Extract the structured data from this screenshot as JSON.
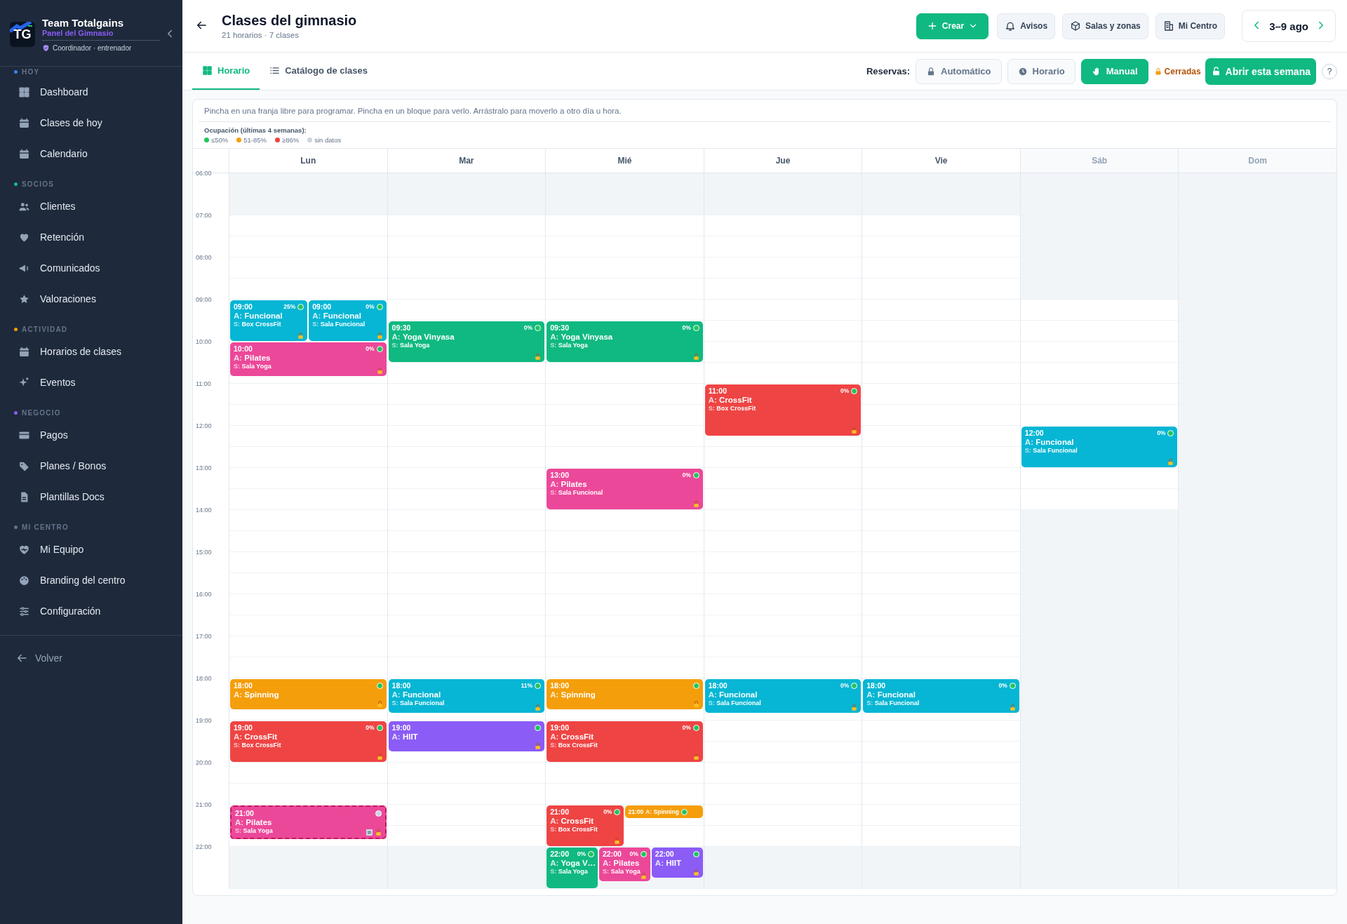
{
  "sidebar": {
    "logo_text": "TG",
    "brand": "Team Totalgains",
    "subtitle": "Panel del Gimnasio",
    "role": "Coordinador · entrenador",
    "sections": [
      {
        "title": "HOY",
        "color": "#3b82f6",
        "items": [
          {
            "label": "Dashboard",
            "selected": false
          },
          {
            "label": "Clases de hoy",
            "selected": false
          },
          {
            "label": "Calendario",
            "selected": false
          }
        ]
      },
      {
        "title": "SOCIOS",
        "color": "#14b8a6",
        "items": [
          {
            "label": "Clientes",
            "selected": false
          },
          {
            "label": "Retención",
            "selected": false
          },
          {
            "label": "Comunicados",
            "selected": false
          },
          {
            "label": "Valoraciones",
            "selected": false
          }
        ]
      },
      {
        "title": "ACTIVIDAD",
        "color": "#f59e0b",
        "items": [
          {
            "label": "Horarios de clases",
            "selected": false
          },
          {
            "label": "Eventos",
            "selected": false
          }
        ]
      },
      {
        "title": "NEGOCIO",
        "color": "#8b5cf6",
        "items": [
          {
            "label": "Pagos",
            "selected": false
          },
          {
            "label": "Planes / Bonos",
            "selected": false
          },
          {
            "label": "Plantillas Docs",
            "selected": false
          }
        ]
      },
      {
        "title": "MI CENTRO",
        "color": "#64748b",
        "items": [
          {
            "label": "Mi Equipo",
            "selected": false
          },
          {
            "label": "Branding del centro",
            "selected": false
          },
          {
            "label": "Configuración",
            "selected": false
          }
        ]
      }
    ],
    "back": "Volver"
  },
  "header": {
    "title": "Clases del gimnasio",
    "subtitle": "21 horarios · 7 clases",
    "buttons": [
      {
        "label": "Crear",
        "kind": "primary"
      },
      {
        "label": "Avisos",
        "kind": "bell"
      },
      {
        "label": "Salas y zonas",
        "kind": "cube"
      },
      {
        "label": "Mi Centro",
        "kind": "building"
      }
    ],
    "week": "3–9 ago"
  },
  "tabs": [
    {
      "label": "Horario",
      "selected": true
    },
    {
      "label": "Catálogo de clases",
      "selected": false
    }
  ],
  "bookings": {
    "label": "Reservas:",
    "modes": [
      {
        "label": "Automático",
        "kind": "lock",
        "selected": false
      },
      {
        "label": "Horario",
        "kind": "clock",
        "selected": false
      },
      {
        "label": "Manual",
        "kind": "hand",
        "selected": true
      }
    ],
    "status": "Cerradas",
    "open_button": "Abrir esta semana",
    "help": "?"
  },
  "calendar": {
    "hint": "Pincha en una franja libre para programar. Pincha en un bloque para verlo. Arrástralo para moverlo a otro día u hora.",
    "legend_title": "Ocupación (últimas 4 semanas):",
    "legend": [
      {
        "label": "≤50%",
        "color": "#22c55e"
      },
      {
        "label": "51-85%",
        "color": "#f59e0b"
      },
      {
        "label": "≥86%",
        "color": "#ef4444"
      },
      {
        "label": "sin datos",
        "color": "#cbd5e1"
      }
    ],
    "hours": [
      "06:00",
      "07:00",
      "08:00",
      "09:00",
      "10:00",
      "11:00",
      "12:00",
      "13:00",
      "14:00",
      "15:00",
      "16:00",
      "17:00",
      "18:00",
      "19:00",
      "20:00",
      "21:00",
      "22:00"
    ],
    "days": [
      {
        "label": "Lun",
        "kind": "weekday",
        "events": [
          {
            "time": "09:00",
            "kind": "full",
            "title": "A: **Funcional**",
            "room": "S: **Box CrossFit**",
            "color": "#06b6d4",
            "occupancy": {
              "text": "25%",
              "color": "#22c55e"
            },
            "locked": true,
            "draft": false,
            "recurring": false
          },
          {
            "time": "09:00",
            "kind": "full",
            "title": "A: **Funcional**",
            "room": "S: **Sala Funcional**",
            "color": "#06b6d4",
            "occupancy": {
              "text": "0%",
              "color": "#22c55e"
            },
            "locked": true,
            "draft": false,
            "recurring": false
          },
          {
            "time": "10:00",
            "kind": "medium",
            "title": "A: **Pilates**",
            "room": "S: **Sala Yoga**",
            "color": "#ec4899",
            "occupancy": {
              "text": "0%",
              "color": "#22c55e"
            },
            "locked": true,
            "draft": false,
            "recurring": false
          },
          {
            "time": "18:00",
            "kind": "short",
            "title": "A: **Spinning**",
            "color": "#f59e0b",
            "occupancy": {
              "color": "#22c55e"
            },
            "locked": true,
            "draft": false,
            "recurring": false
          },
          {
            "time": "19:00",
            "kind": "full",
            "title": "A: **CrossFit**",
            "room": "S: **Box CrossFit**",
            "color": "#ef4444",
            "occupancy": {
              "text": "0%",
              "color": "#22c55e"
            },
            "locked": true,
            "draft": false,
            "recurring": false
          },
          {
            "time": "21:00",
            "kind": "medium",
            "title": "A: **Pilates**",
            "room": "S: **Sala Yoga**",
            "color": "#ec4899",
            "occupancy": {
              "color": "#cbd5e1"
            },
            "locked": true,
            "draft": true,
            "recurring": true
          }
        ]
      },
      {
        "label": "Mar",
        "kind": "weekday",
        "events": [
          {
            "time": "09:30",
            "kind": "full",
            "title": "A: **Yoga Vinyasa**",
            "room": "S: **Sala Yoga**",
            "color": "#10b981",
            "occupancy": {
              "text": "0%",
              "color": "#22c55e"
            },
            "locked": true,
            "draft": false,
            "recurring": false
          },
          {
            "time": "18:00",
            "kind": "medium",
            "title": "A: **Funcional**",
            "room": "S: **Sala Funcional**",
            "color": "#06b6d4",
            "occupancy": {
              "text": "11%",
              "color": "#22c55e"
            },
            "locked": true,
            "draft": false,
            "recurring": false
          },
          {
            "time": "19:00",
            "kind": "short",
            "title": "A: **HIIT**",
            "color": "#8b5cf6",
            "occupancy": {
              "color": "#22c55e"
            },
            "locked": true,
            "draft": false,
            "recurring": false
          }
        ]
      },
      {
        "label": "Mié",
        "kind": "weekday",
        "events": [
          {
            "time": "09:30",
            "kind": "full",
            "title": "A: **Yoga Vinyasa**",
            "room": "S: **Sala Yoga**",
            "color": "#10b981",
            "occupancy": {
              "text": "0%",
              "color": "#22c55e"
            },
            "locked": true,
            "draft": false,
            "recurring": false
          },
          {
            "time": "13:00",
            "kind": "full",
            "title": "A: **Pilates**",
            "room": "S: **Sala Funcional**",
            "color": "#ec4899",
            "occupancy": {
              "text": "0%",
              "color": "#22c55e"
            },
            "locked": true,
            "draft": false,
            "recurring": false
          },
          {
            "time": "18:00",
            "kind": "short",
            "title": "A: **Spinning**",
            "color": "#f59e0b",
            "occupancy": {
              "color": "#22c55e"
            },
            "locked": true,
            "draft": false,
            "recurring": false
          },
          {
            "time": "19:00",
            "kind": "full",
            "title": "A: **CrossFit**",
            "room": "S: **Box CrossFit**",
            "color": "#ef4444",
            "occupancy": {
              "text": "0%",
              "color": "#22c55e"
            },
            "locked": true,
            "draft": false,
            "recurring": false
          },
          {
            "time": "21:00",
            "kind": "full",
            "title": "A: **CrossFit**",
            "room": "S: **Box CrossFit**",
            "color": "#ef4444",
            "occupancy": {
              "text": "0%",
              "color": "#22c55e"
            },
            "locked": true,
            "draft": false,
            "recurring": false
          },
          {
            "time": "21:00",
            "kind": "mini",
            "title": "A: **Spinning**",
            "color": "#f59e0b",
            "occupancy": {
              "color": "#22c55e"
            },
            "locked": false,
            "draft": false,
            "recurring": false
          },
          {
            "time": "22:00",
            "kind": "full",
            "title": "A: **Yoga V…**",
            "room": "S: **Sala Yoga**",
            "color": "#10b981",
            "occupancy": {
              "text": "0%",
              "color": "#22c55e"
            },
            "locked": false,
            "draft": false,
            "recurring": false
          },
          {
            "time": "22:00",
            "kind": "medium",
            "title": "A: **Pilates**",
            "room": "S: **Sala Yoga**",
            "color": "#ec4899",
            "occupancy": {
              "text": "0%",
              "color": "#22c55e"
            },
            "locked": true,
            "draft": false,
            "recurring": false
          },
          {
            "time": "22:00",
            "kind": "short",
            "title": "A: **HIIT**",
            "color": "#8b5cf6",
            "occupancy": {
              "color": "#22c55e"
            },
            "locked": true,
            "draft": false,
            "recurring": false
          }
        ]
      },
      {
        "label": "Jue",
        "kind": "weekday",
        "events": [
          {
            "time": "11:00",
            "kind": "long",
            "title": "A: **CrossFit**",
            "room": "S: **Box CrossFit**",
            "color": "#ef4444",
            "occupancy": {
              "text": "0%",
              "color": "#22c55e"
            },
            "locked": true,
            "draft": false,
            "recurring": false
          },
          {
            "time": "18:00",
            "kind": "medium",
            "title": "A: **Funcional**",
            "room": "S: **Sala Funcional**",
            "color": "#06b6d4",
            "occupancy": {
              "text": "0%",
              "color": "#22c55e"
            },
            "locked": true,
            "draft": false,
            "recurring": false
          }
        ]
      },
      {
        "label": "Vie",
        "kind": "weekday",
        "events": [
          {
            "time": "18:00",
            "kind": "medium",
            "title": "A: **Funcional**",
            "room": "S: **Sala Funcional**",
            "color": "#06b6d4",
            "occupancy": {
              "text": "0%",
              "color": "#22c55e"
            },
            "locked": true,
            "draft": false,
            "recurring": false
          }
        ]
      },
      {
        "label": "Sáb",
        "kind": "reduced",
        "events": [
          {
            "time": "12:00",
            "kind": "full",
            "title": "A: **Funcional**",
            "room": "S: **Sala Funcional**",
            "color": "#06b6d4",
            "occupancy": {
              "text": "0%",
              "color": "#22c55e"
            },
            "locked": true,
            "draft": false,
            "recurring": false
          }
        ]
      },
      {
        "label": "Dom",
        "kind": "closed"
      }
    ]
  }
}
